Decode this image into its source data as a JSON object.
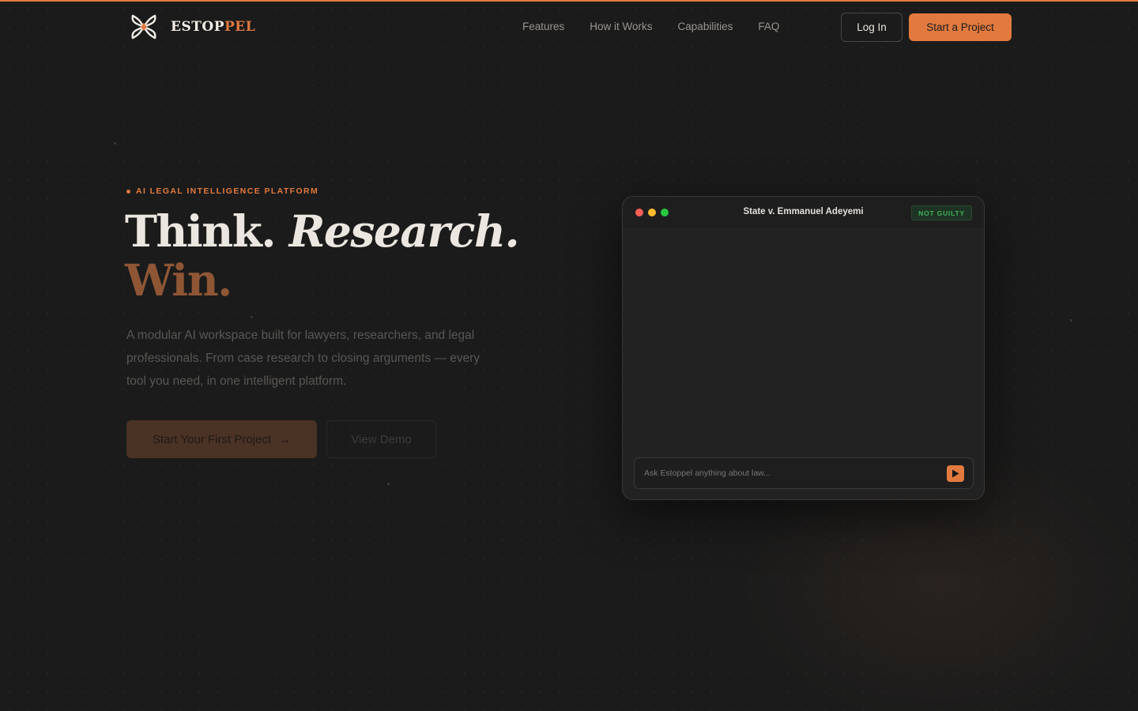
{
  "brand": {
    "name_main": "ESTOP",
    "name_accent": "PEL"
  },
  "nav": {
    "links": [
      "Features",
      "How it Works",
      "Capabilities",
      "FAQ"
    ],
    "login_label": "Log In",
    "start_label": "Start a Project"
  },
  "hero": {
    "eyebrow": "AI LEGAL INTELLIGENCE PLATFORM",
    "headline_1": "Think.",
    "headline_2": "Research.",
    "headline_3": "Win.",
    "subtitle": "A modular AI workspace built for lawyers, researchers, and legal professionals. From case research to closing arguments — every tool you need, in one intelligent platform.",
    "cta_primary": "Start Your First Project",
    "cta_primary_arrow": "→",
    "cta_secondary": "View Demo"
  },
  "window": {
    "title": "State v. Emmanuel Adeyemi",
    "badge": "NOT GUILTY",
    "input_placeholder": "Ask Estoppel anything about law..."
  },
  "colors": {
    "accent": "#e27a3f",
    "background": "#1b1b1b",
    "badge_green": "#3fb25a",
    "traffic_red": "#ff5f57",
    "traffic_yellow": "#febc2e",
    "traffic_green": "#28c840"
  },
  "icons": {
    "logo": "estoppel-logo-icon",
    "send": "play-send-icon",
    "arrow": "arrow-right-icon"
  }
}
